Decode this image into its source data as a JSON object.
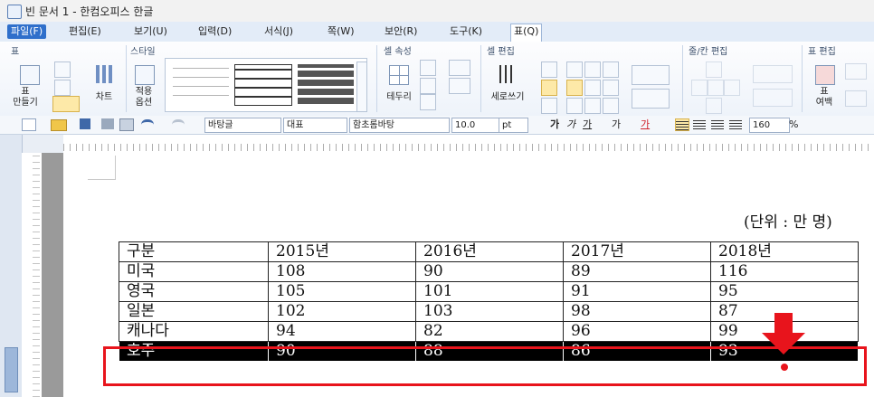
{
  "window": {
    "title": "빈 문서 1 - 한컴오피스 한글"
  },
  "menu": [
    "파일(F)",
    "편집(E)",
    "보기(U)",
    "입력(D)",
    "서식(J)",
    "쪽(W)",
    "보안(R)",
    "도구(K)",
    "표(Q)"
  ],
  "ribbon": {
    "groups": [
      "표",
      "스타일",
      "셀 속성",
      "셀 편집",
      "줄/칸 편집",
      "표 편집"
    ],
    "buttons": {
      "make_table": "표\n만들기",
      "chart": "차트",
      "apply_options": "적용\n옵션",
      "border": "테두리",
      "vertical_text": "세로쓰기",
      "table_margin": "표\n여백"
    }
  },
  "toolbar": {
    "style": "바탕글",
    "language": "대표",
    "font": "함초롬바탕",
    "font_size": "10.0",
    "unit": "pt",
    "zoom": "160",
    "zoom_unit": "%"
  },
  "document": {
    "unit_note": "(단위 : 만 명)",
    "table": {
      "header": [
        "구분",
        "2015년",
        "2016년",
        "2017년",
        "2018년"
      ],
      "rows": [
        [
          "미국",
          "108",
          "90",
          "89",
          "116"
        ],
        [
          "영국",
          "105",
          "101",
          "91",
          "95"
        ],
        [
          "일본",
          "102",
          "103",
          "98",
          "87"
        ],
        [
          "캐나다",
          "94",
          "82",
          "96",
          "99"
        ],
        [
          "호주",
          "90",
          "88",
          "86",
          "93"
        ]
      ],
      "selected_row": 4
    }
  },
  "colors": {
    "highlight": "#e8141c",
    "selection": "#000000",
    "ribbon_accent": "#2f6fcb"
  }
}
